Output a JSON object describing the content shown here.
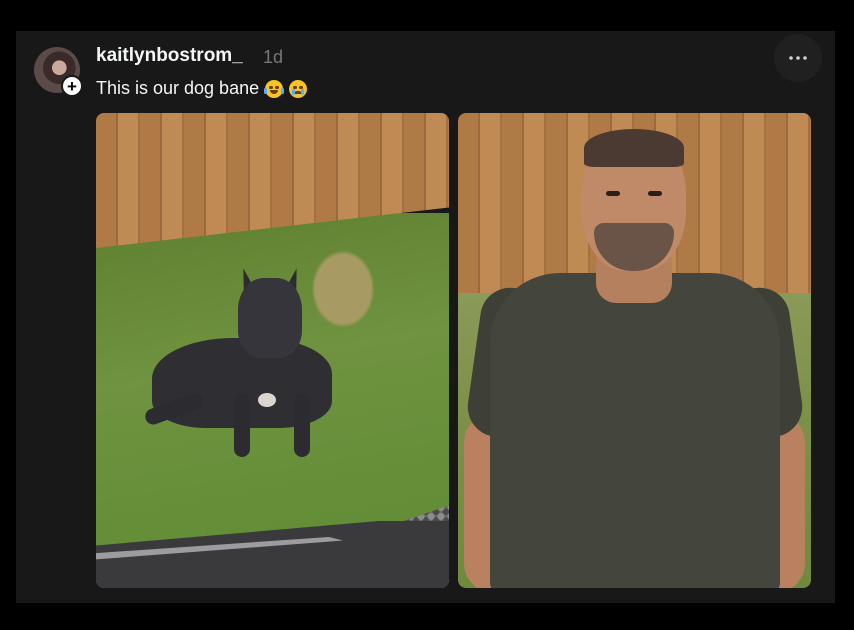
{
  "post": {
    "username": "kaitlynbostrom_",
    "timestamp": "1d",
    "caption": "This is our dog bane",
    "more_label": "•••"
  },
  "icons": {
    "avatar_badge": "plus-icon",
    "more": "more-options-icon",
    "caption_emojis": [
      "laughing-emoji-icon",
      "crying-emoji-icon"
    ]
  },
  "colors": {
    "background": "#000000",
    "card": "#181818",
    "text_primary": "#f3f5f7",
    "text_secondary": "#777777"
  }
}
